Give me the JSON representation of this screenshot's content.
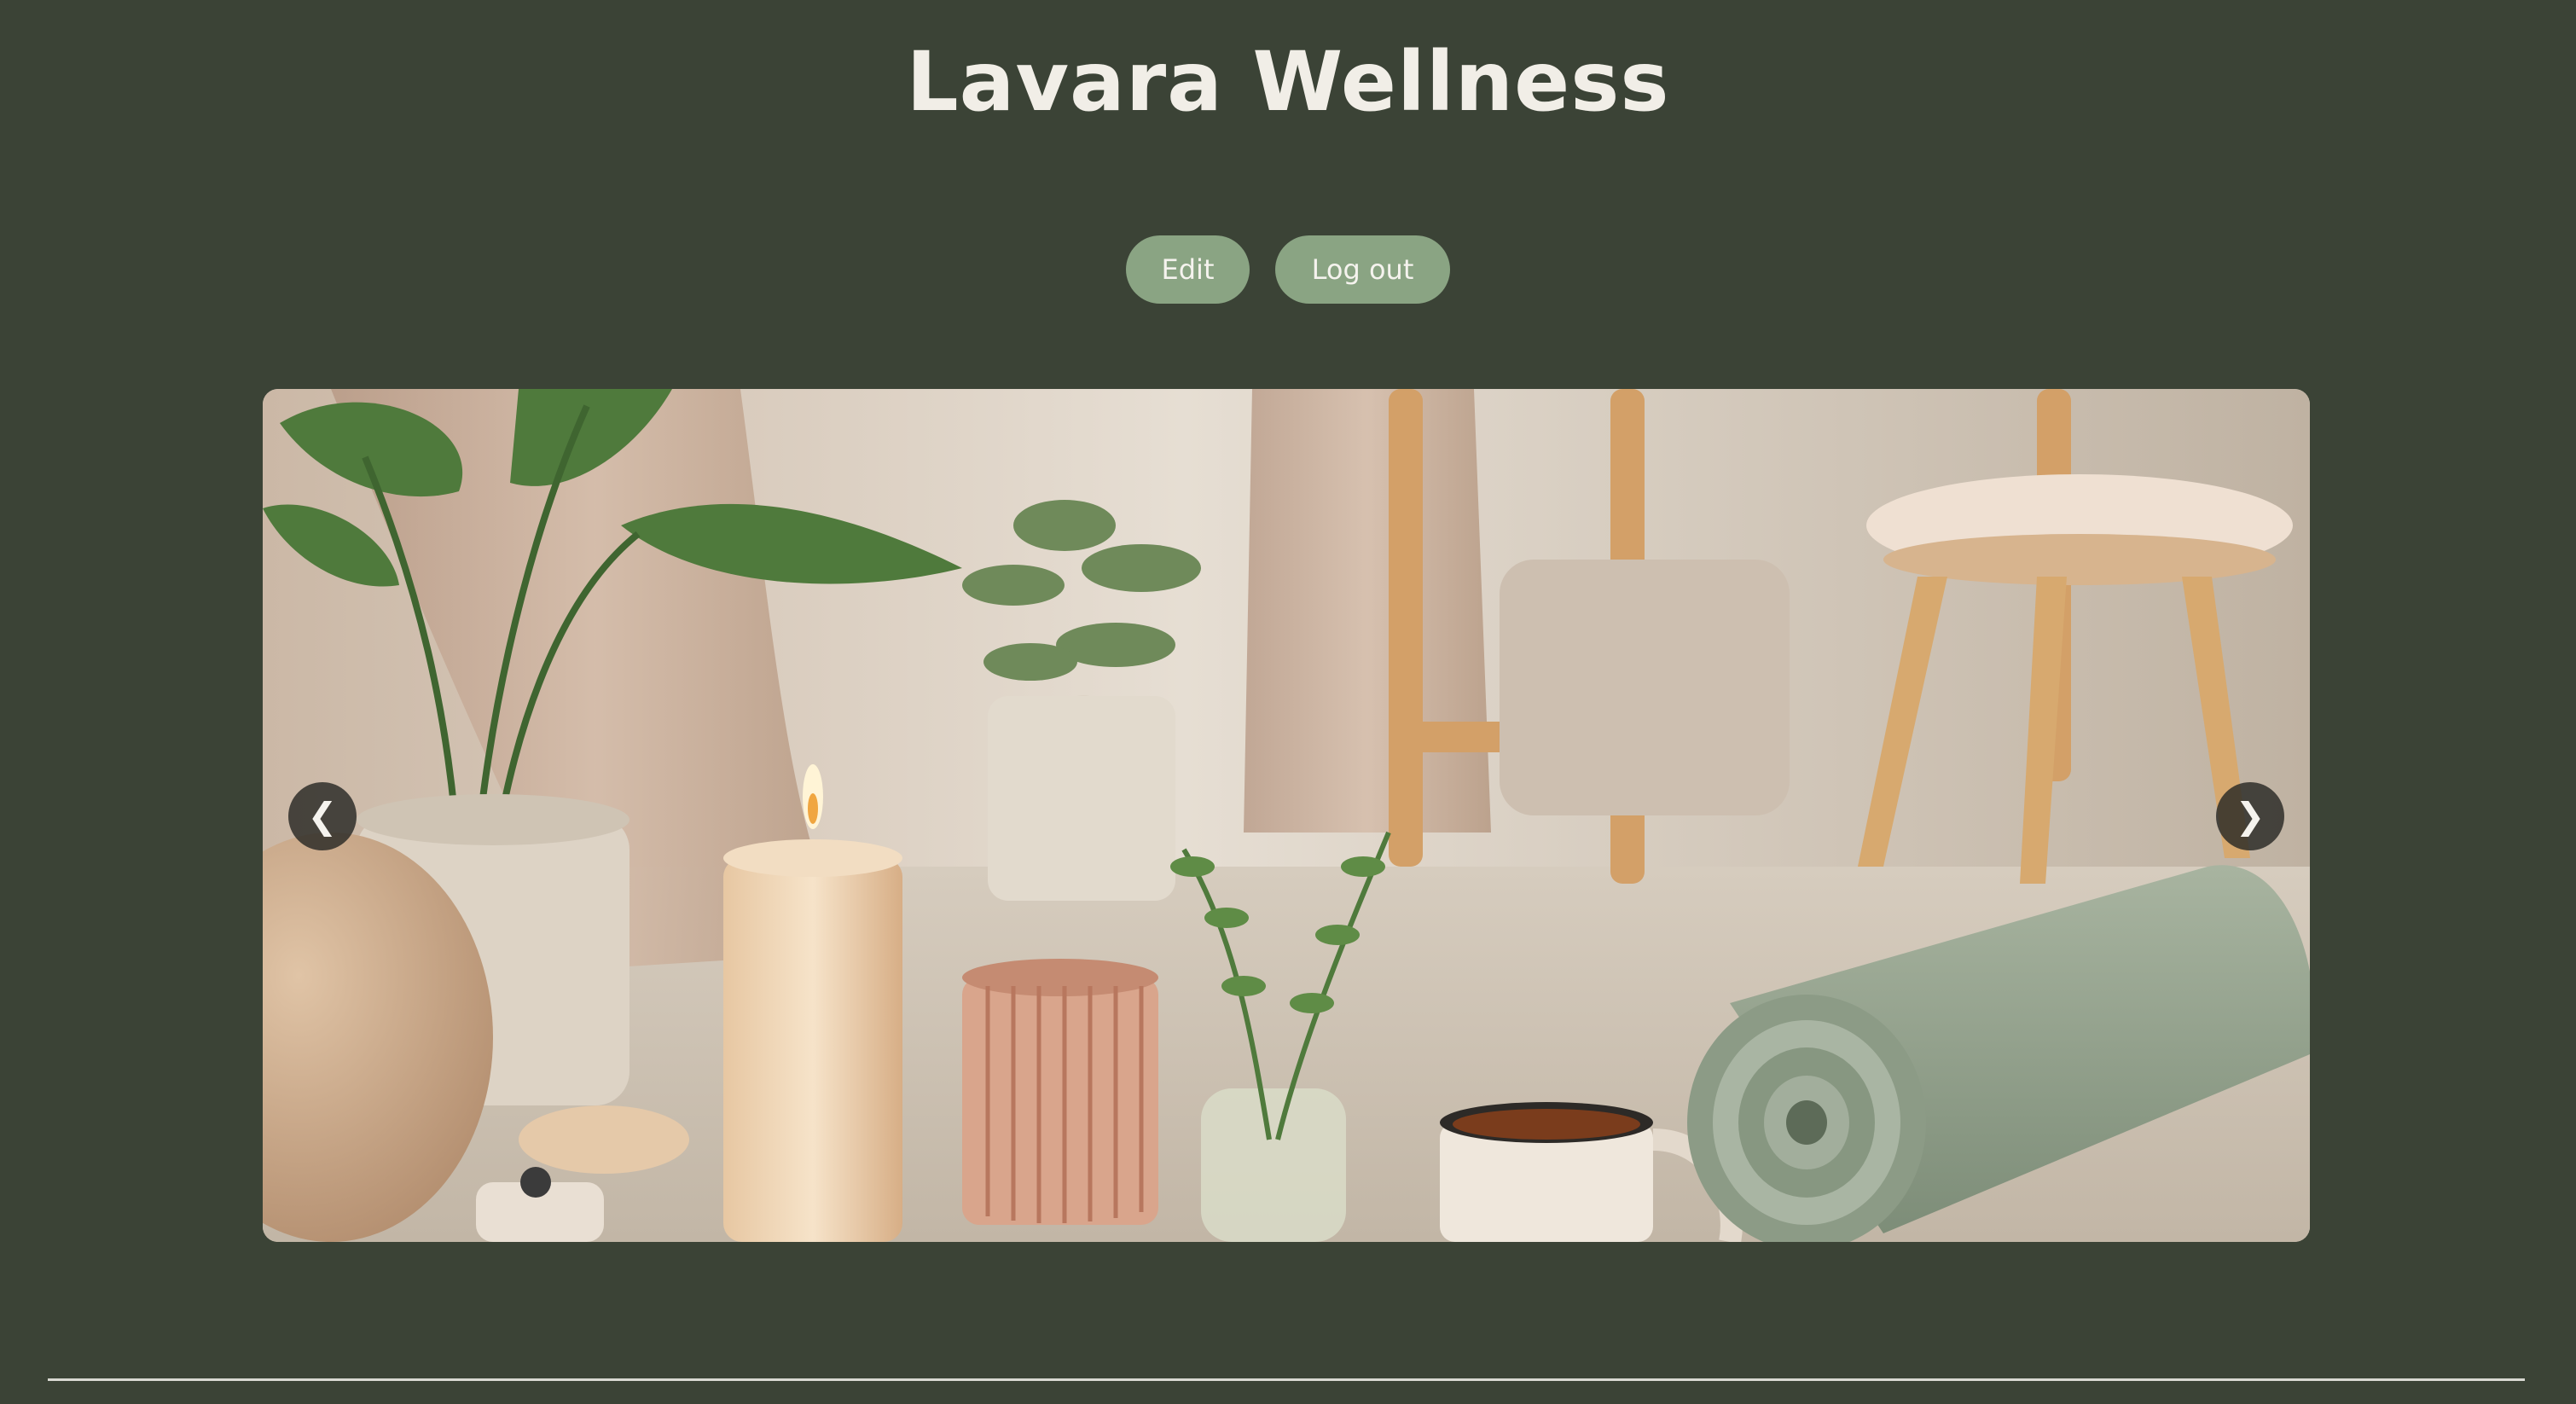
{
  "site": {
    "title": "Lavara Wellness"
  },
  "actions": {
    "edit_label": "Edit",
    "logout_label": "Log out"
  },
  "carousel": {
    "prev_icon": "chevron-left-icon",
    "prev_glyph": "❮",
    "next_icon": "chevron-right-icon",
    "next_glyph": "❯",
    "slide_subject": "wellness-room-photo"
  },
  "colors": {
    "background": "#3b4336",
    "button": "#8aa483",
    "title": "#f1eee7"
  }
}
